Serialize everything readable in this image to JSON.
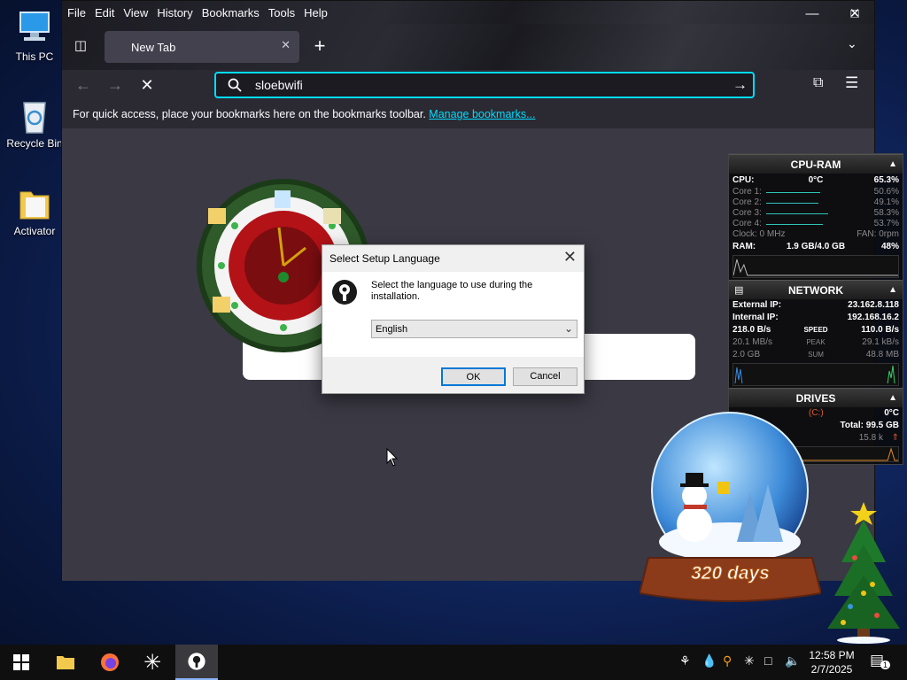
{
  "desktop": {
    "icons": [
      {
        "label": "This PC"
      },
      {
        "label": "Recycle Bin"
      },
      {
        "label": "Activator"
      }
    ]
  },
  "browser": {
    "menu": [
      "File",
      "Edit",
      "View",
      "History",
      "Bookmarks",
      "Tools",
      "Help"
    ],
    "tab_title": "New Tab",
    "url_value": "sloebwifi",
    "bookmarks_hint": "For quick access, place your bookmarks here on the bookmarks toolbar.",
    "manage_bookmarks": "Manage bookmarks..."
  },
  "dialog": {
    "title": "Select Setup Language",
    "message": "Select the language to use during the installation.",
    "selected_language": "English",
    "ok_label": "OK",
    "cancel_label": "Cancel"
  },
  "monitor": {
    "cpu_ram": {
      "title": "CPU-RAM",
      "cpu_label": "CPU:",
      "cpu_temp": "0°C",
      "cpu_usage": "65.3%",
      "cores": [
        {
          "label": "Core 1:",
          "value": "50.6%",
          "fraction": 0.506
        },
        {
          "label": "Core 2:",
          "value": "49.1%",
          "fraction": 0.491
        },
        {
          "label": "Core 3:",
          "value": "58.3%",
          "fraction": 0.583
        },
        {
          "label": "Core 4:",
          "value": "53.7%",
          "fraction": 0.537
        }
      ],
      "clock": "Clock: 0 MHz",
      "fan": "FAN: 0rpm",
      "ram_label": "RAM:",
      "ram_value": "1.9 GB/4.0 GB",
      "ram_pct": "48%"
    },
    "network": {
      "title": "NETWORK",
      "external_label": "External IP:",
      "external_ip": "23.162.8.118",
      "internal_label": "Internal IP:",
      "internal_ip": "192.168.16.2",
      "speed_down": "218.0 B/s",
      "speed_label": "SPEED",
      "speed_up": "110.0 B/s",
      "peak_down": "20.1 MB/s",
      "peak_label": "PEAK",
      "peak_up": "29.1 kB/s",
      "sum_down": "2.0 GB",
      "sum_label": "SUM",
      "sum_up": "48.8 MB"
    },
    "drives": {
      "title": "DRIVES",
      "drive": "(C:)",
      "temp": "0°C",
      "total": "Total: 99.5 GB",
      "rate": "15.8 k"
    }
  },
  "globe": {
    "days_text": "320 days"
  },
  "taskbar": {
    "time": "12:58 PM",
    "date": "2/7/2025",
    "notification_count": "1"
  },
  "colors": {
    "accent": "#00ddff",
    "browser_bg": "#2b2a33",
    "content_bg": "#3a3944",
    "dialog_bg": "#f0f0f0",
    "graph_line": "#2ec4b6"
  }
}
